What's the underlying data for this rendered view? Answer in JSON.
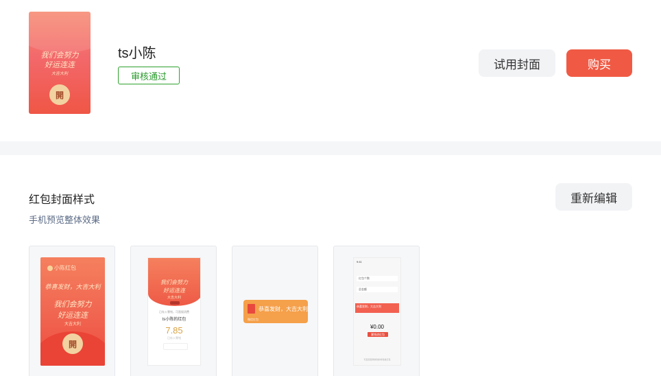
{
  "cover": {
    "name": "ts小陈",
    "status": "审核通过",
    "line1": "我们会努力",
    "line2": "好运连连",
    "line3": "大吉大利",
    "seal": "開"
  },
  "actions": {
    "try_cover": "试用封面",
    "buy": "购买",
    "re_edit": "重新编辑"
  },
  "section": {
    "title": "红包封面样式",
    "subtitle": "手机预览整体效果"
  },
  "previews": {
    "envelope": {
      "brand": "小陈红包",
      "wish": "恭喜发财，大吉大利",
      "line1": "我们会努力",
      "line2": "好运连连",
      "line3": "大吉大利",
      "seal": "開"
    },
    "opened": {
      "line1": "我们会努力",
      "line2": "好运连连",
      "line3": "大吉大利",
      "hint": "已存入零钱，可直接消费",
      "from": "ts小陈的红包",
      "amount": "7.85",
      "pay": "已存入零钱"
    },
    "bubble": {
      "text": "恭喜发财，大吉大利",
      "footer": "微信红包"
    },
    "phone": {
      "status": "9:41",
      "row1": "红包个数",
      "row2": "总金额",
      "row3": "恭喜发财，大吉大利",
      "amount": "¥0.00",
      "button": "塞钱进红包",
      "footer": "可直接使用收到的零钱发红包"
    }
  },
  "colors": {
    "accent": "#f05a44",
    "success": "#2ca02c",
    "subtitle": "#5a6a85"
  }
}
